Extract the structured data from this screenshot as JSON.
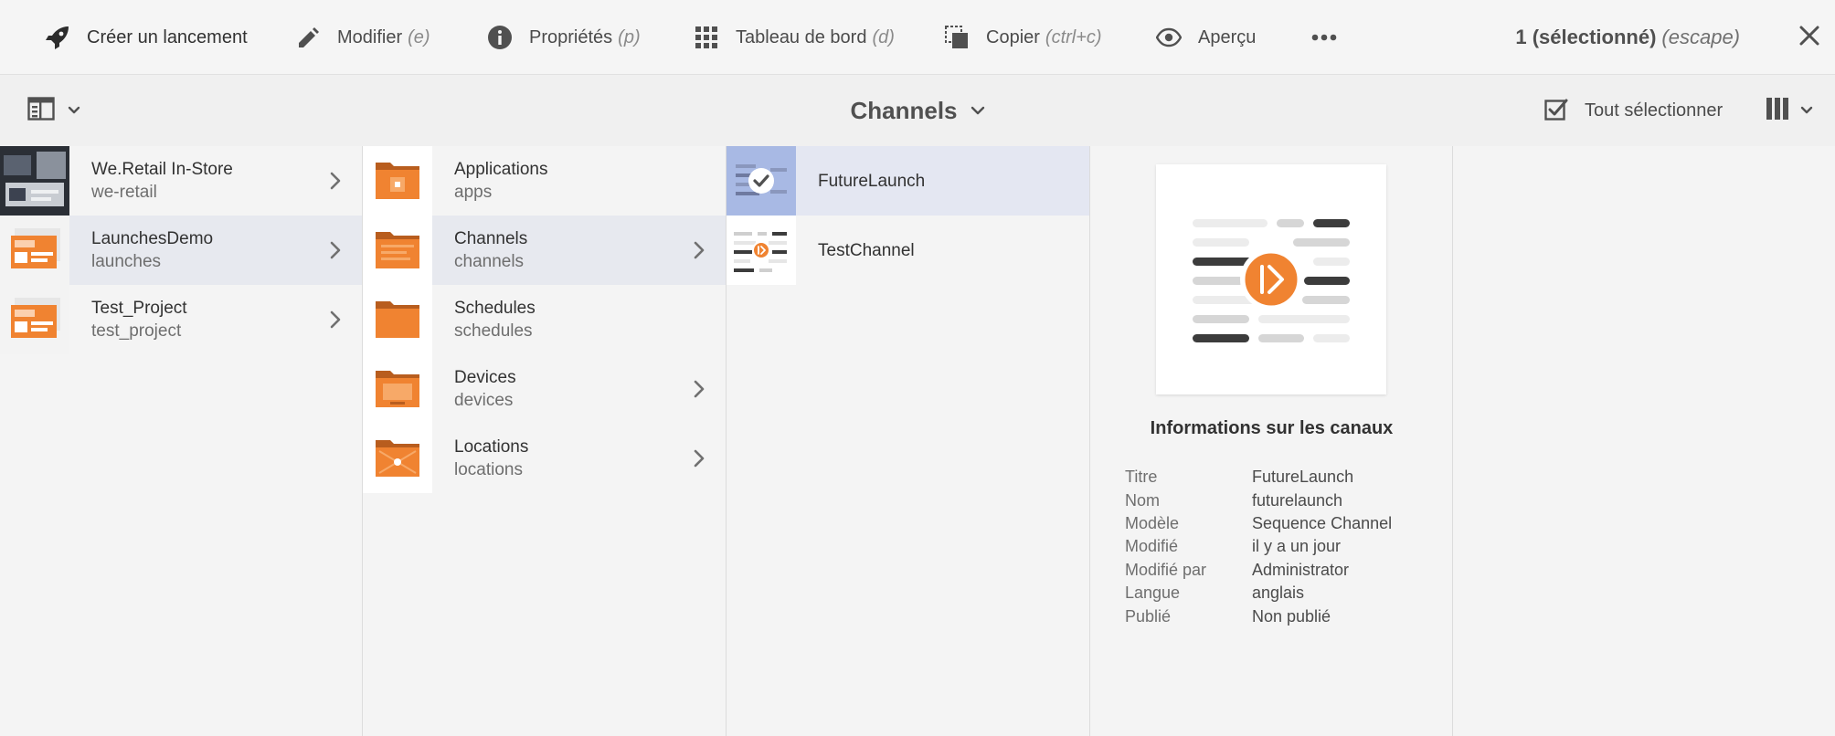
{
  "actionbar": {
    "create_launch": "Créer un lancement",
    "edit": {
      "label": "Modifier",
      "shortcut": "(e)"
    },
    "properties": {
      "label": "Propriétés",
      "shortcut": "(p)"
    },
    "dashboard": {
      "label": "Tableau de bord",
      "shortcut": "(d)"
    },
    "copy": {
      "label": "Copier",
      "shortcut": "(ctrl+c)"
    },
    "preview": "Aperçu",
    "more_icon": "more-icon",
    "selected_count": "1 (sélectionné)",
    "escape_hint": "(escape)"
  },
  "titlebar": {
    "title": "Channels",
    "select_all": "Tout sélectionner"
  },
  "columns": {
    "col1": [
      {
        "title": "We.Retail In-Store",
        "name": "we-retail"
      },
      {
        "title": "LaunchesDemo",
        "name": "launches"
      },
      {
        "title": "Test_Project",
        "name": "test_project"
      }
    ],
    "col2": [
      {
        "title": "Applications",
        "name": "apps"
      },
      {
        "title": "Channels",
        "name": "channels"
      },
      {
        "title": "Schedules",
        "name": "schedules"
      },
      {
        "title": "Devices",
        "name": "devices"
      },
      {
        "title": "Locations",
        "name": "locations"
      }
    ],
    "col3": [
      {
        "title": "FutureLaunch"
      },
      {
        "title": "TestChannel"
      }
    ]
  },
  "preview": {
    "heading": "Informations sur les canaux",
    "meta": [
      {
        "key": "Titre",
        "value": "FutureLaunch"
      },
      {
        "key": "Nom",
        "value": "futurelaunch"
      },
      {
        "key": "Modèle",
        "value": "Sequence Channel"
      },
      {
        "key": "Modifié",
        "value": "il y a un jour"
      },
      {
        "key": "Modifié par",
        "value": "Administrator"
      },
      {
        "key": "Langue",
        "value": "anglais"
      },
      {
        "key": "Publié",
        "value": "Non publié"
      }
    ]
  },
  "colors": {
    "accent_orange": "#f08331",
    "selection_blue": "#6f8fd9",
    "row_active": "#e7e9ef"
  }
}
